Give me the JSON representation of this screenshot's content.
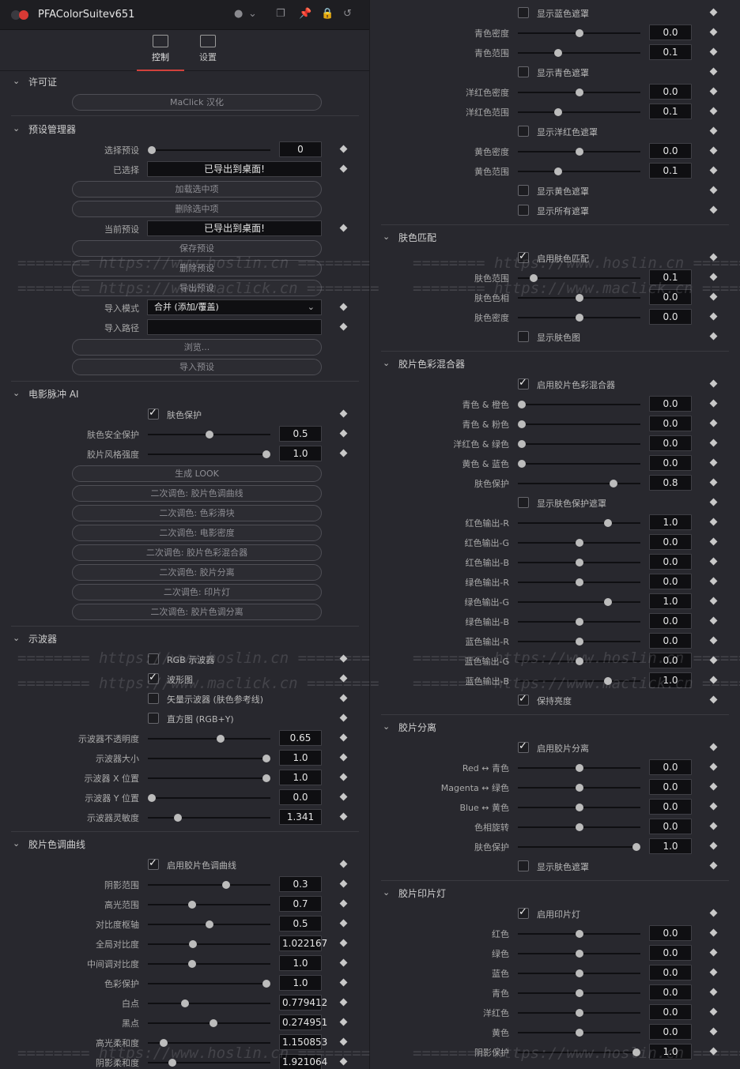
{
  "window": {
    "title": "PFAColorSuitev651"
  },
  "tabs": [
    {
      "label": "控制"
    },
    {
      "label": "设置"
    }
  ],
  "sections": {
    "license": "许可证",
    "presets": "预设管理器",
    "ai": "电影脉冲 AI",
    "scopes": "示波器",
    "curve": "胶片色调曲线",
    "skin": "肤色匹配",
    "mixer": "胶片色彩混合器",
    "sep": "胶片分离",
    "printer": "胶片印片灯"
  },
  "license": {
    "button": "MaClick 汉化"
  },
  "presets": {
    "select_label": "选择预设",
    "select_value": "0",
    "selected_label": "已选择",
    "selected_value": "已导出到桌面!",
    "btn_load": "加载选中项",
    "btn_delete": "删除选中项",
    "current_label": "当前预设",
    "current_value": "已导出到桌面!",
    "btn_save": "保存预设",
    "btn_del_preset": "删除预设",
    "btn_export": "导出预设",
    "mode_label": "导入模式",
    "mode_value": "合并 (添加/覆盖)",
    "path_label": "导入路径",
    "path_value": "",
    "btn_browse": "浏览...",
    "btn_import": "导入预设"
  },
  "ai": {
    "cb_skin": "肤色保护",
    "safe_label": "肤色安全保护",
    "safe_value": "0.5",
    "safe_level": 0.5,
    "strength_label": "胶片风格强度",
    "strength_value": "1.0",
    "strength_level": 1.0,
    "btn_look": "生成 LOOK",
    "btn2": "二次调色: 胶片色调曲线",
    "btn3": "二次调色: 色彩滑块",
    "btn4": "二次调色: 电影密度",
    "btn5": "二次调色: 胶片色彩混合器",
    "btn6": "二次调色: 胶片分离",
    "btn7": "二次调色: 印片灯",
    "btn8": "二次调色: 胶片色调分离"
  },
  "scopes": {
    "cb_rgb": "RGB 示波器",
    "cb_wave": "波形图",
    "cb_vec": "矢量示波器 (肤色参考线)",
    "cb_hist": "直方图 (RGB+Y)",
    "opacity_label": "示波器不透明度",
    "opacity_value": "0.65",
    "opacity_level": 0.6,
    "size_label": "示波器大小",
    "size_value": "1.0",
    "size_level": 1.0,
    "xpos_label": "示波器 X 位置",
    "xpos_value": "1.0",
    "xpos_level": 1.0,
    "ypos_label": "示波器 Y 位置",
    "ypos_value": "0.0",
    "ypos_level": 0.0,
    "sens_label": "示波器灵敏度",
    "sens_value": "1.341",
    "sens_level": 0.23
  },
  "curve": {
    "cb_enable": "启用胶片色调曲线",
    "shadow_label": "阴影范围",
    "shadow_value": "0.3",
    "shadow_level": 0.65,
    "high_label": "高光范围",
    "high_value": "0.7",
    "high_level": 0.35,
    "pivot_label": "对比度枢轴",
    "pivot_value": "0.5",
    "pivot_level": 0.5,
    "gcontrast_label": "全局对比度",
    "gcontrast_value": "1.022167",
    "gcontrast_level": 0.36,
    "mcontrast_label": "中间调对比度",
    "mcontrast_value": "1.0",
    "mcontrast_level": 0.35,
    "protect_label": "色彩保护",
    "protect_value": "1.0",
    "protect_level": 1.0,
    "white_label": "白点",
    "white_value": "0.779412",
    "white_level": 0.29,
    "black_label": "黑点",
    "black_value": "0.274951",
    "black_level": 0.54,
    "hsoft_label": "高光柔和度",
    "hsoft_value": "1.150853",
    "hsoft_level": 0.1,
    "ssoft_label": "阴影柔和度",
    "ssoft_value": "1.921064",
    "ssoft_level": 0.18
  },
  "right_top": {
    "cb_bluemask": "显示蓝色遮罩",
    "cyan_den_label": "青色密度",
    "cyan_den_value": "0.0",
    "cyan_den_level": 0.5,
    "cyan_rng_label": "青色范围",
    "cyan_rng_value": "0.1",
    "cyan_rng_level": 0.32,
    "cb_cyanmask": "显示青色遮罩",
    "mag_den_label": "洋红色密度",
    "mag_den_value": "0.0",
    "mag_den_level": 0.5,
    "mag_rng_label": "洋红色范围",
    "mag_rng_value": "0.1",
    "mag_rng_level": 0.32,
    "cb_magmask": "显示洋红色遮罩",
    "yel_den_label": "黄色密度",
    "yel_den_value": "0.0",
    "yel_den_level": 0.5,
    "yel_rng_label": "黄色范围",
    "yel_rng_value": "0.1",
    "yel_rng_level": 0.32,
    "cb_yelmask": "显示黄色遮罩",
    "cb_allmask": "显示所有遮罩"
  },
  "skin": {
    "cb_enable": "启用肤色匹配",
    "range_label": "肤色范围",
    "range_value": "0.1",
    "range_level": 0.1,
    "hue_label": "肤色色相",
    "hue_value": "0.0",
    "hue_level": 0.5,
    "den_label": "肤色密度",
    "den_value": "0.0",
    "den_level": 0.5,
    "cb_map": "显示肤色图"
  },
  "mixer": {
    "cb_enable": "启用胶片色彩混合器",
    "co_label": "青色 & 橙色",
    "co_value": "0.0",
    "co_level": 0.0,
    "cp_label": "青色 & 粉色",
    "cp_value": "0.0",
    "cp_level": 0.0,
    "mg_label": "洋红色 & 绿色",
    "mg_value": "0.0",
    "mg_level": 0.0,
    "yb_label": "黄色 & 蓝色",
    "yb_value": "0.0",
    "yb_level": 0.0,
    "sp_label": "肤色保护",
    "sp_value": "0.8",
    "sp_level": 0.8,
    "cb_spmask": "显示肤色保护遮罩",
    "rr_label": "红色输出-R",
    "rr_value": "1.0",
    "rr_level": 0.75,
    "rg_label": "红色输出-G",
    "rg_value": "0.0",
    "rg_level": 0.5,
    "rb_label": "红色输出-B",
    "rb_value": "0.0",
    "rb_level": 0.5,
    "gr_label": "绿色输出-R",
    "gr_value": "0.0",
    "gr_level": 0.5,
    "gg_label": "绿色输出-G",
    "gg_value": "1.0",
    "gg_level": 0.75,
    "gb_label": "绿色输出-B",
    "gb_value": "0.0",
    "gb_level": 0.5,
    "br_label": "蓝色输出-R",
    "br_value": "0.0",
    "br_level": 0.5,
    "bg_label": "蓝色输出-G",
    "bg_value": "0.0",
    "bg_level": 0.5,
    "bb_label": "蓝色输出-B",
    "bb_value": "1.0",
    "bb_level": 0.75,
    "cb_lum": "保持亮度"
  },
  "sep": {
    "cb_enable": "启用胶片分离",
    "rc_label": "Red ↔ 青色",
    "rc_value": "0.0",
    "rc_level": 0.5,
    "mg_label": "Magenta ↔ 绿色",
    "mg_value": "0.0",
    "mg_level": 0.5,
    "by_label": "Blue ↔ 黄色",
    "by_value": "0.0",
    "by_level": 0.5,
    "hue_label": "色相旋转",
    "hue_value": "0.0",
    "hue_level": 0.5,
    "sp_label": "肤色保护",
    "sp_value": "1.0",
    "sp_level": 1.0,
    "cb_mask": "显示肤色遮罩"
  },
  "printer": {
    "cb_enable": "启用印片灯",
    "r_label": "红色",
    "r_value": "0.0",
    "r_level": 0.5,
    "g_label": "绿色",
    "g_value": "0.0",
    "g_level": 0.5,
    "b_label": "蓝色",
    "b_value": "0.0",
    "b_level": 0.5,
    "c_label": "青色",
    "c_value": "0.0",
    "c_level": 0.5,
    "m_label": "洋红色",
    "m_value": "0.0",
    "m_level": 0.5,
    "y_label": "黄色",
    "y_value": "0.0",
    "y_level": 0.5,
    "sh_label": "阴影保护",
    "sh_value": "1.0",
    "sh_level": 1.0
  },
  "watermarks": {
    "a": "======== https://www.hoslin.cn ========",
    "b": "======== https://www.maclick.cn ========"
  }
}
